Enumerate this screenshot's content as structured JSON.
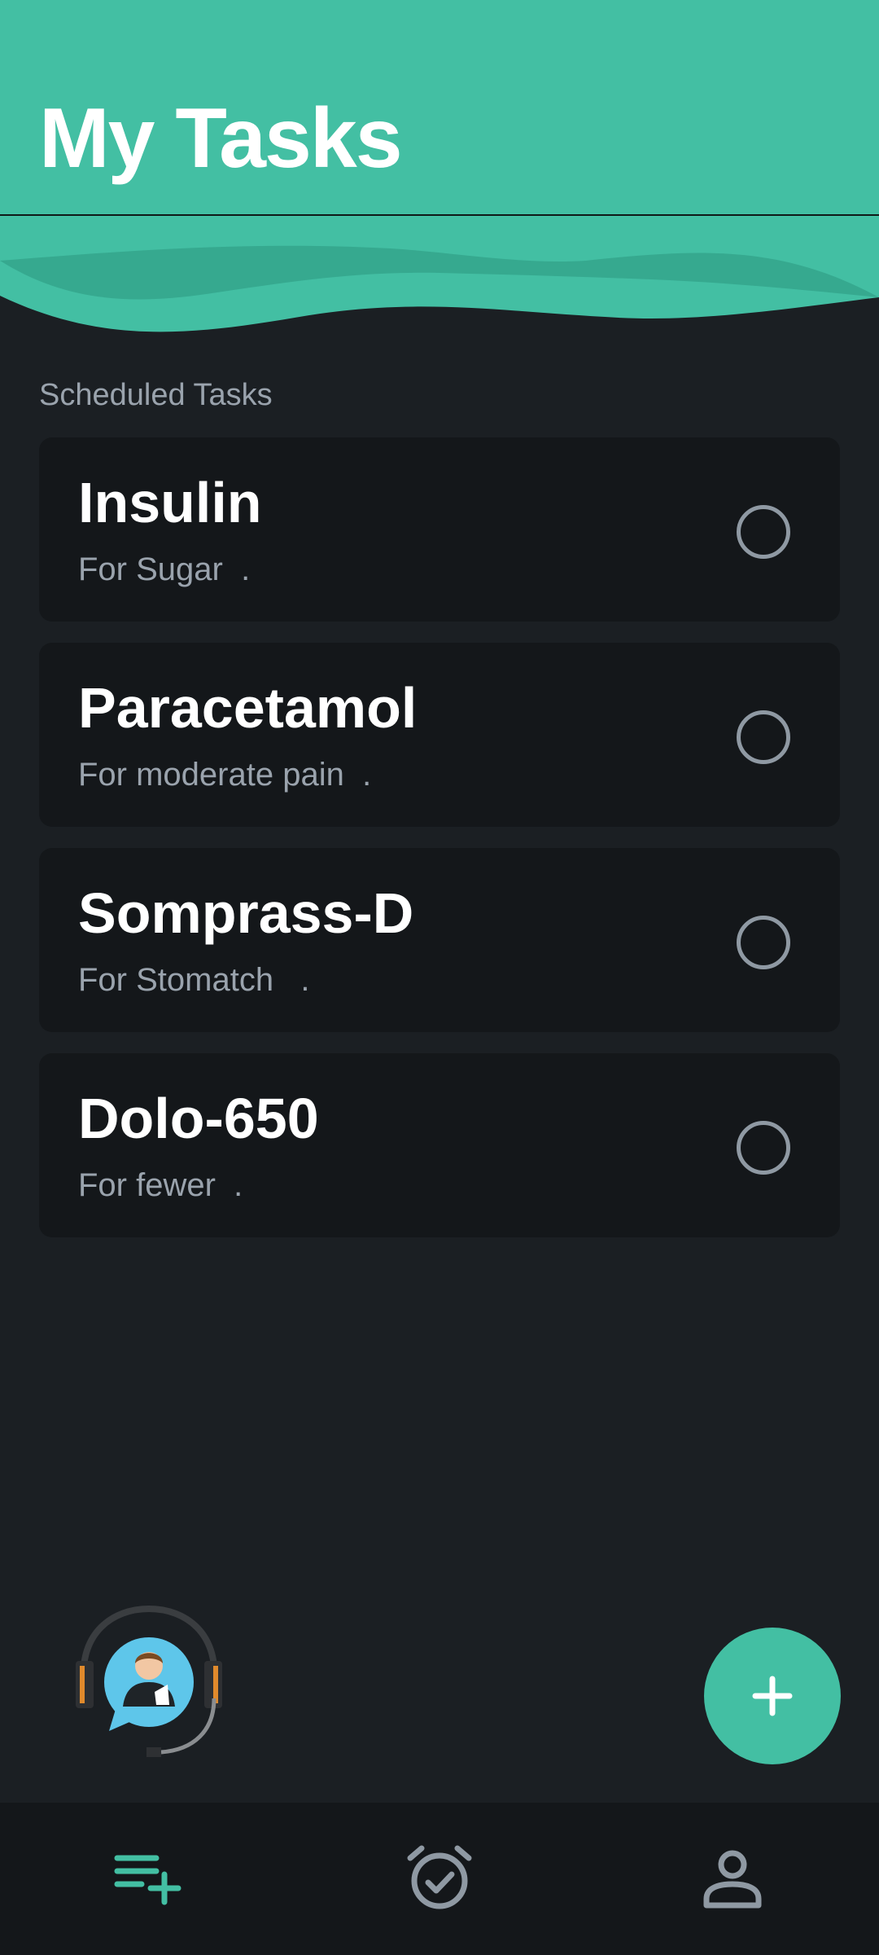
{
  "header": {
    "title": "My Tasks"
  },
  "section": {
    "label": "Scheduled Tasks"
  },
  "tasks": [
    {
      "name": "Insulin",
      "desc": "For Sugar  ."
    },
    {
      "name": "Paracetamol",
      "desc": "For moderate pain  ."
    },
    {
      "name": "Somprass-D",
      "desc": "For Stomatch   ."
    },
    {
      "name": "Dolo-650",
      "desc": "For fewer  ."
    }
  ],
  "bottom_nav": {
    "items": [
      {
        "icon": "playlist-add-icon",
        "active": true
      },
      {
        "icon": "alarm-check-icon",
        "active": false
      },
      {
        "icon": "person-icon",
        "active": false
      }
    ]
  },
  "colors": {
    "accent": "#43bfa3",
    "background": "#1b1f23",
    "card": "#14171a",
    "muted_text": "#9aa3ad"
  }
}
